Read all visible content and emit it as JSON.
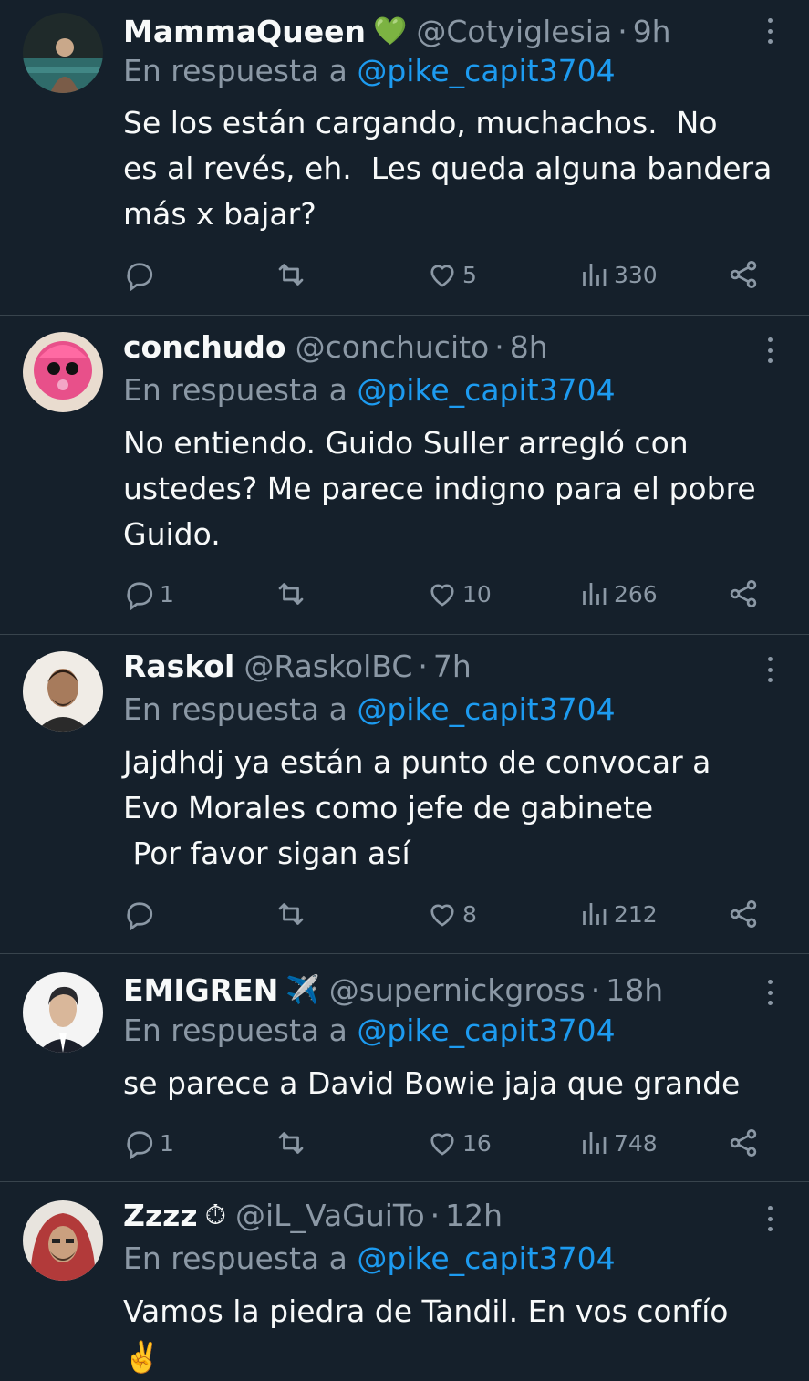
{
  "reply_prefix": "En respuesta a",
  "tweets": [
    {
      "name": "MammaQueen",
      "emoji": "💚",
      "handle": "@Cotyiglesia",
      "time": "9h",
      "reply_to": "@pike_capit3704",
      "text": "Se los están cargando, muchachos.  No\nes al revés, eh.  Les queda alguna bandera\nmás x bajar?",
      "replies": "",
      "likes": "5",
      "views": "330",
      "avatar_color": "#2d3b3a"
    },
    {
      "name": "conchudo",
      "emoji": "",
      "handle": "@conchucito",
      "time": "8h",
      "reply_to": "@pike_capit3704",
      "text": "No entiendo. Guido Suller arregló con\nustedes? Me parece indigno para el pobre\nGuido.",
      "replies": "1",
      "likes": "10",
      "views": "266",
      "avatar_color": "#e8508a"
    },
    {
      "name": "Raskol",
      "emoji": "",
      "handle": "@RaskolBC",
      "time": "7h",
      "reply_to": "@pike_capit3704",
      "text": "Jajdhdj ya están a punto de convocar a\nEvo Morales como jefe de gabinete\n Por favor sigan así",
      "replies": "",
      "likes": "8",
      "views": "212",
      "avatar_color": "#6b5a4a"
    },
    {
      "name": "EMIGREN",
      "emoji": "✈️",
      "handle": "@supernickgross",
      "time": "18h",
      "reply_to": "@pike_capit3704",
      "text": "se parece a David Bowie jaja que grande",
      "replies": "1",
      "likes": "16",
      "views": "748",
      "avatar_color": "#f2f2f2"
    },
    {
      "name": "Zzzz",
      "emoji": "⏱",
      "handle": "@iL_VaGuiTo",
      "time": "12h",
      "reply_to": "@pike_capit3704",
      "text": "Vamos la piedra de Tandil. En vos confío\n✌️",
      "replies": "",
      "likes": "",
      "views": "",
      "avatar_color": "#b23a3a"
    }
  ]
}
